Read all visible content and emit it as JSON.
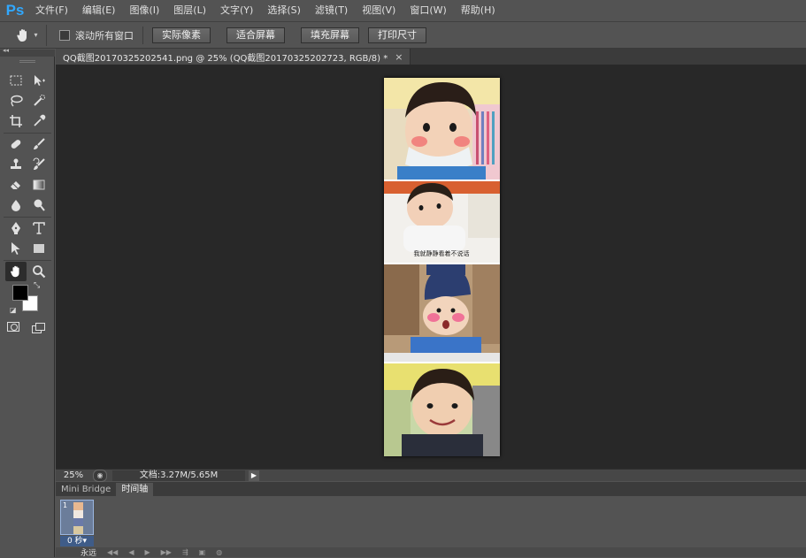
{
  "app": {
    "logo": "Ps",
    "menus": [
      "文件(F)",
      "编辑(E)",
      "图像(I)",
      "图层(L)",
      "文字(Y)",
      "选择(S)",
      "滤镜(T)",
      "视图(V)",
      "窗口(W)",
      "帮助(H)"
    ]
  },
  "options_bar": {
    "scroll_all_windows": "滚动所有窗口",
    "scroll_all_checked": false,
    "buttons": [
      "实际像素",
      "适合屏幕",
      "填充屏幕",
      "打印尺寸"
    ]
  },
  "document": {
    "tab_title": "QQ截图20170325202541.png @ 25% (QQ截图20170325202723, RGB/8) *",
    "close": "×",
    "image_caption": "我就静静看着不说话"
  },
  "status_bar": {
    "zoom": "25%",
    "doc_size": "文档:3.27M/5.65M"
  },
  "panels": {
    "tabs": [
      "Mini Bridge",
      "时间轴"
    ],
    "active_tab": "时间轴",
    "frame_number": "1",
    "frame_delay": "0 秒▾",
    "loop": "永远"
  },
  "colors": {
    "foreground": "#000000",
    "background": "#ffffff",
    "accent": "#31a8ff"
  },
  "icons": [
    "hand-icon",
    "marquee-icon",
    "move-icon",
    "lasso-icon",
    "quick-select-icon",
    "crop-icon",
    "eyedropper-icon",
    "healing-icon",
    "brush-icon",
    "stamp-icon",
    "history-brush-icon",
    "eraser-icon",
    "gradient-icon",
    "blur-icon",
    "dodge-icon",
    "pen-icon",
    "type-icon",
    "path-select-icon",
    "shape-icon",
    "zoom-icon"
  ]
}
